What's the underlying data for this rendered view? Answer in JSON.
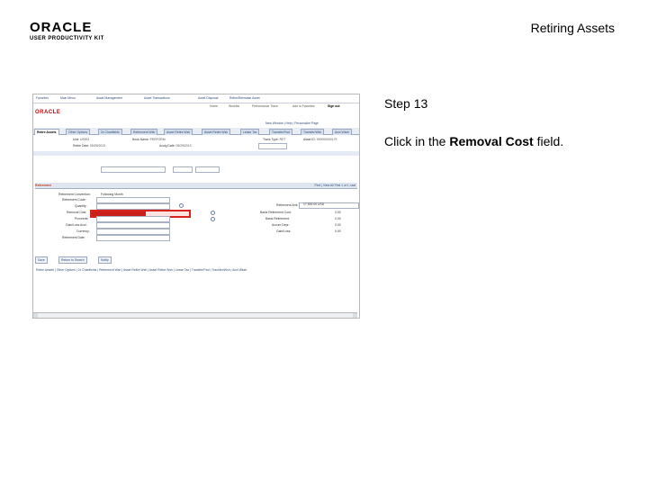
{
  "header": {
    "logo_main": "ORACLE",
    "logo_sub": "USER PRODUCTIVITY KIT",
    "doc_title": "Retiring Assets"
  },
  "step": {
    "label": "Step 13",
    "instruction_prefix": "Click in the ",
    "instruction_field": "Removal Cost",
    "instruction_suffix": " field."
  },
  "screenshot": {
    "top_nav": [
      "Favorites",
      "Main Menu",
      "Asset Management",
      "Asset Transactions",
      "Asset Disposal",
      "Retire/Reinstate Asset"
    ],
    "top_links": [
      "Home",
      "Worklist",
      "Performance Trace",
      "Add to Favorites",
      "Sign out"
    ],
    "logo": "ORACLE",
    "nav_row": "New Window | Help | Personalize Page",
    "tabs": [
      "Retire Assets",
      "Other Options",
      "2x Chartfields",
      "Retirement Wsh",
      "Asset Retire Wsh",
      "Asset Retire Wsh",
      "Lease Tax",
      "Transfer/Fwd",
      "Transfer/Wsh",
      "Acct Wksh"
    ],
    "rows": [
      {
        "label": "Unit:",
        "value": "US001"
      },
      {
        "label": "Retire Date:",
        "value": "05/29/2013"
      },
      {
        "label": "Book Name:",
        "value": "PERFORM"
      },
      {
        "label": "Trans Type:",
        "value": "RET"
      },
      {
        "label": "Acctg Date:",
        "value": "05/29/2013"
      },
      {
        "label": "Asset ID:",
        "value": "000000000179"
      }
    ],
    "section_title": "Retirement",
    "section_nav": "Find | View All   First 1 of 1 Last",
    "fields": [
      {
        "label": "Retirement Convention:",
        "value": "Following Month"
      },
      {
        "label": "Retirement Code:",
        "value": "Retirement by Sale"
      },
      {
        "label": "Quantity:",
        "value": "1.0000"
      },
      {
        "label": "Removal Cost:",
        "value": "0.00"
      },
      {
        "label": "Proceeds:",
        "value": "0.00"
      },
      {
        "label": "Gain/Loss Acct:",
        "value": ""
      },
      {
        "label": "Currency:",
        "value": "USD"
      },
      {
        "label": "Retirement Date:",
        "value": ""
      }
    ],
    "right_fields": [
      {
        "label": "Retirement Amt:",
        "value": "17,500.00 USD"
      },
      {
        "label": "Basis Retirement Cost:",
        "value": "0.00"
      },
      {
        "label": "Basis Retirement:",
        "value": "0.00"
      },
      {
        "label": "Accum Depr:",
        "value": "0.00"
      },
      {
        "label": "Gain/Loss:",
        "value": "0.00"
      }
    ],
    "buttons": [
      "Save",
      "Return to Search",
      "Notify"
    ],
    "footer_links": "Retire Assets | Other Options | 2x Chartfields | Retirement Wsh | Asset Retire Wsh | Asset Retire Wsh | Lease Tax | Transfer/Fwd | Transfer/Wsh | Acct Wksh"
  }
}
